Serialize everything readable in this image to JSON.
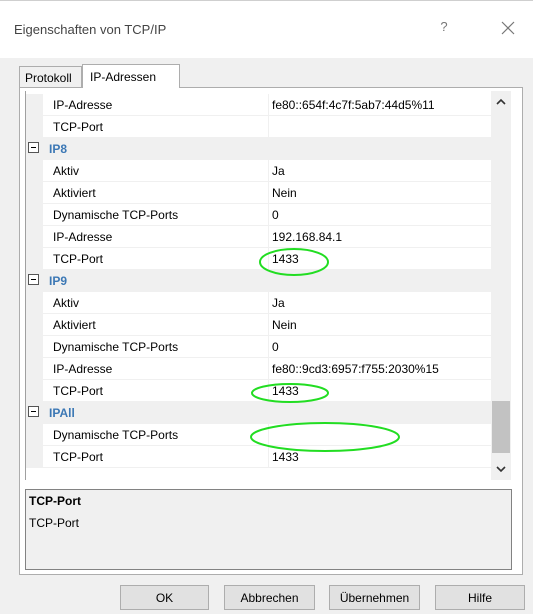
{
  "window": {
    "title": "Eigenschaften von TCP/IP",
    "help_glyph": "?"
  },
  "tabs": [
    {
      "label": "Protokoll"
    },
    {
      "label": "IP-Adressen"
    }
  ],
  "grid": {
    "rows": [
      {
        "kind": "prop",
        "label": "IP-Adresse",
        "value": "fe80::654f:4c7f:5ab7:44d5%11"
      },
      {
        "kind": "prop",
        "label": "TCP-Port",
        "value": ""
      },
      {
        "kind": "cat",
        "label": "IP8"
      },
      {
        "kind": "prop",
        "label": "Aktiv",
        "value": "Ja"
      },
      {
        "kind": "prop",
        "label": "Aktiviert",
        "value": "Nein"
      },
      {
        "kind": "prop",
        "label": "Dynamische TCP-Ports",
        "value": "0"
      },
      {
        "kind": "prop",
        "label": "IP-Adresse",
        "value": "192.168.84.1"
      },
      {
        "kind": "prop",
        "label": "TCP-Port",
        "value": "1433"
      },
      {
        "kind": "cat",
        "label": "IP9"
      },
      {
        "kind": "prop",
        "label": "Aktiv",
        "value": "Ja"
      },
      {
        "kind": "prop",
        "label": "Aktiviert",
        "value": "Nein"
      },
      {
        "kind": "prop",
        "label": "Dynamische TCP-Ports",
        "value": "0"
      },
      {
        "kind": "prop",
        "label": "IP-Adresse",
        "value": "fe80::9cd3:6957:f755:2030%15"
      },
      {
        "kind": "prop",
        "label": "TCP-Port",
        "value": "1433"
      },
      {
        "kind": "cat",
        "label": "IPAll"
      },
      {
        "kind": "prop",
        "label": "Dynamische TCP-Ports",
        "value": ""
      },
      {
        "kind": "prop",
        "label": "TCP-Port",
        "value": "1433"
      }
    ]
  },
  "description": {
    "title": "TCP-Port",
    "text": "TCP-Port"
  },
  "buttons": {
    "ok": "OK",
    "cancel": "Abbrechen",
    "apply": "Übernehmen",
    "help": "Hilfe"
  },
  "colors": {
    "category_text": "#3c78b5",
    "annotation": "#22dd22"
  }
}
